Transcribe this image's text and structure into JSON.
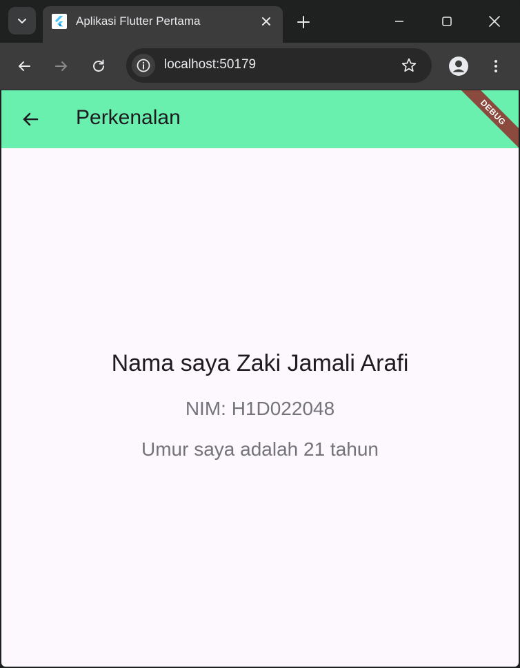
{
  "browser": {
    "tab_title": "Aplikasi Flutter Pertama",
    "url": "localhost:50179"
  },
  "app": {
    "appbar_title": "Perkenalan",
    "debug_banner": "DEBUG",
    "name_line": "Nama saya Zaki Jamali Arafi",
    "nim_line": "NIM: H1D022048",
    "age_line": "Umur saya adalah 21 tahun"
  },
  "colors": {
    "appbar": "#69f0ae",
    "background": "#fdf7fe",
    "debug_banner": "#8a4a3e",
    "browser_frame": "#1f2020",
    "toolbar": "#3c3c3c"
  }
}
